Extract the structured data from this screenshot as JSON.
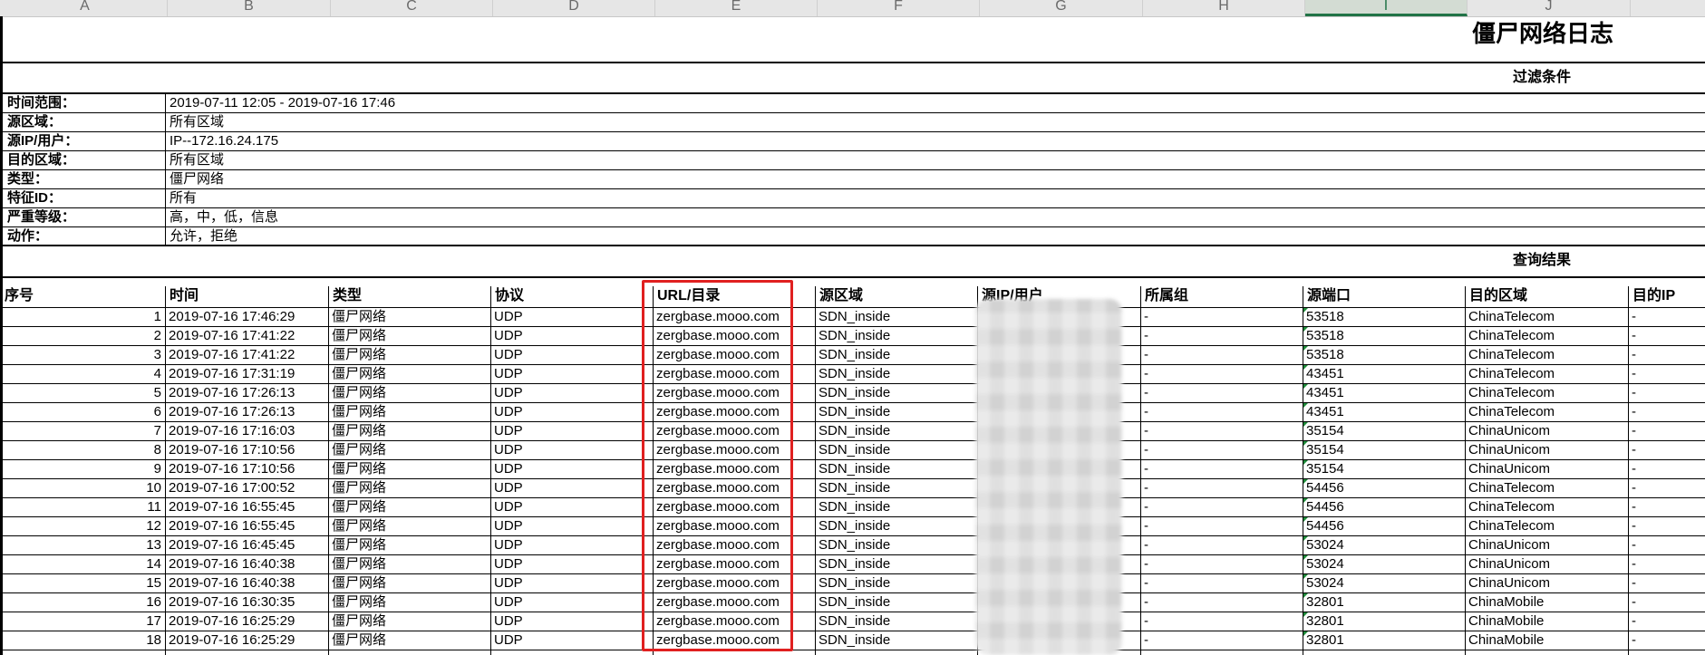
{
  "column_letters": [
    "A",
    "B",
    "C",
    "D",
    "E",
    "F",
    "G",
    "H",
    "I",
    "J"
  ],
  "selected_column": "I",
  "report": {
    "title": "僵尸网络日志",
    "filter_section_title": "过滤条件",
    "results_section_title": "查询结果"
  },
  "filters": [
    {
      "label": "时间范围：",
      "value": "2019-07-11 12:05 - 2019-07-16 17:46"
    },
    {
      "label": "源区域：",
      "value": "所有区域"
    },
    {
      "label": "源IP/用户：",
      "value": "IP--172.16.24.175"
    },
    {
      "label": "目的区域：",
      "value": "所有区域"
    },
    {
      "label": "类型：",
      "value": "僵尸网络"
    },
    {
      "label": "特征ID：",
      "value": "所有"
    },
    {
      "label": "严重等级：",
      "value": "高，中，低，信息"
    },
    {
      "label": "动作：",
      "value": "允许，拒绝"
    }
  ],
  "table": {
    "headers": [
      "序号",
      "时间",
      "类型",
      "协议",
      "URL/目录",
      "源区域",
      "源IP/用户",
      "所属组",
      "源端口",
      "目的区域",
      "目的IP"
    ],
    "rows": [
      [
        "1",
        "2019-07-16 17:46:29",
        "僵尸网络",
        "UDP",
        "zergbase.mooo.com",
        "SDN_inside",
        "",
        "-",
        "53518",
        "ChinaTelecom",
        "-"
      ],
      [
        "2",
        "2019-07-16 17:41:22",
        "僵尸网络",
        "UDP",
        "zergbase.mooo.com",
        "SDN_inside",
        "",
        "-",
        "53518",
        "ChinaTelecom",
        "-"
      ],
      [
        "3",
        "2019-07-16 17:41:22",
        "僵尸网络",
        "UDP",
        "zergbase.mooo.com",
        "SDN_inside",
        "",
        "-",
        "53518",
        "ChinaTelecom",
        "-"
      ],
      [
        "4",
        "2019-07-16 17:31:19",
        "僵尸网络",
        "UDP",
        "zergbase.mooo.com",
        "SDN_inside",
        "",
        "-",
        "43451",
        "ChinaTelecom",
        "-"
      ],
      [
        "5",
        "2019-07-16 17:26:13",
        "僵尸网络",
        "UDP",
        "zergbase.mooo.com",
        "SDN_inside",
        "",
        "-",
        "43451",
        "ChinaTelecom",
        "-"
      ],
      [
        "6",
        "2019-07-16 17:26:13",
        "僵尸网络",
        "UDP",
        "zergbase.mooo.com",
        "SDN_inside",
        "",
        "-",
        "43451",
        "ChinaTelecom",
        "-"
      ],
      [
        "7",
        "2019-07-16 17:16:03",
        "僵尸网络",
        "UDP",
        "zergbase.mooo.com",
        "SDN_inside",
        "",
        "-",
        "35154",
        "ChinaUnicom",
        "-"
      ],
      [
        "8",
        "2019-07-16 17:10:56",
        "僵尸网络",
        "UDP",
        "zergbase.mooo.com",
        "SDN_inside",
        "",
        "-",
        "35154",
        "ChinaUnicom",
        "-"
      ],
      [
        "9",
        "2019-07-16 17:10:56",
        "僵尸网络",
        "UDP",
        "zergbase.mooo.com",
        "SDN_inside",
        "",
        "-",
        "35154",
        "ChinaUnicom",
        "-"
      ],
      [
        "10",
        "2019-07-16 17:00:52",
        "僵尸网络",
        "UDP",
        "zergbase.mooo.com",
        "SDN_inside",
        "",
        "-",
        "54456",
        "ChinaTelecom",
        "-"
      ],
      [
        "11",
        "2019-07-16 16:55:45",
        "僵尸网络",
        "UDP",
        "zergbase.mooo.com",
        "SDN_inside",
        "",
        "-",
        "54456",
        "ChinaTelecom",
        "-"
      ],
      [
        "12",
        "2019-07-16 16:55:45",
        "僵尸网络",
        "UDP",
        "zergbase.mooo.com",
        "SDN_inside",
        "",
        "-",
        "54456",
        "ChinaTelecom",
        "-"
      ],
      [
        "13",
        "2019-07-16 16:45:45",
        "僵尸网络",
        "UDP",
        "zergbase.mooo.com",
        "SDN_inside",
        "",
        "-",
        "53024",
        "ChinaUnicom",
        "-"
      ],
      [
        "14",
        "2019-07-16 16:40:38",
        "僵尸网络",
        "UDP",
        "zergbase.mooo.com",
        "SDN_inside",
        "",
        "-",
        "53024",
        "ChinaUnicom",
        "-"
      ],
      [
        "15",
        "2019-07-16 16:40:38",
        "僵尸网络",
        "UDP",
        "zergbase.mooo.com",
        "SDN_inside",
        "",
        "-",
        "53024",
        "ChinaUnicom",
        "-"
      ],
      [
        "16",
        "2019-07-16 16:30:35",
        "僵尸网络",
        "UDP",
        "zergbase.mooo.com",
        "SDN_inside",
        "",
        "-",
        "32801",
        "ChinaMobile",
        "-"
      ],
      [
        "17",
        "2019-07-16 16:25:29",
        "僵尸网络",
        "UDP",
        "zergbase.mooo.com",
        "SDN_inside",
        "",
        "-",
        "32801",
        "ChinaMobile",
        "-"
      ],
      [
        "18",
        "2019-07-16 16:25:29",
        "僵尸网络",
        "UDP",
        "zergbase.mooo.com",
        "SDN_inside",
        "",
        "-",
        "32801",
        "ChinaMobile",
        "-"
      ]
    ]
  },
  "annotations": {
    "highlight_color": "#e02020",
    "highlighted_column": "URL/目录",
    "redacted_column": "源IP/用户"
  },
  "colors": {
    "grid": "#000000",
    "header_bg": "#e6e6e6",
    "selected_column_accent": "#217346",
    "error_indicator": "#1f8b3a"
  }
}
